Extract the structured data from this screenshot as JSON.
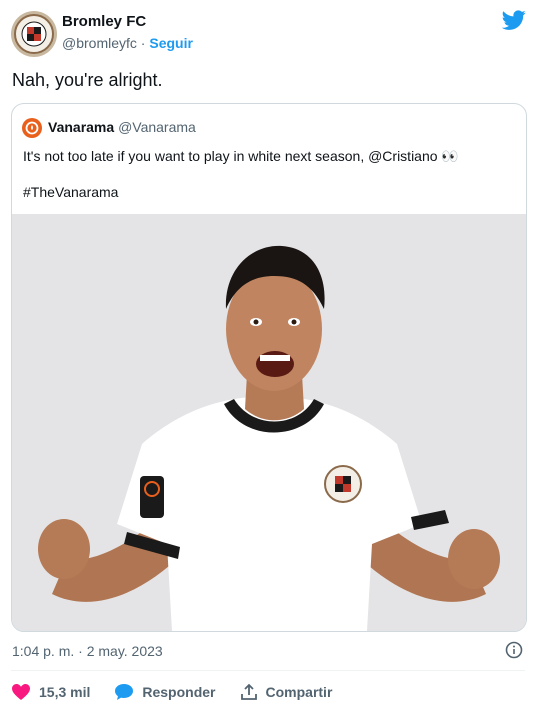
{
  "header": {
    "display_name": "Bromley FC",
    "handle": "@bromleyfc",
    "separator": "·",
    "follow_label": "Seguir",
    "avatar_icon": "bromley-crest-icon",
    "platform_icon": "twitter-bird-icon"
  },
  "tweet": {
    "text": "Nah, you're alright."
  },
  "quote": {
    "display_name": "Vanarama",
    "handle": "@Vanarama",
    "text": "It's not too late if you want to play in white next season, @Cristiano 👀",
    "hashtag": "#TheVanarama",
    "avatar_icon": "vanarama-logo-icon",
    "image_description_icon": "player-photo"
  },
  "footer": {
    "timestamp": "1:04 p. m. · 2 may. 2023",
    "info_icon": "info-icon",
    "like_count": "15,3 mil",
    "reply_label": "Responder",
    "share_label": "Compartir"
  },
  "colors": {
    "accent": "#1d9bf0",
    "like": "#f91880",
    "text": "#0f1419",
    "muted": "#536471"
  }
}
